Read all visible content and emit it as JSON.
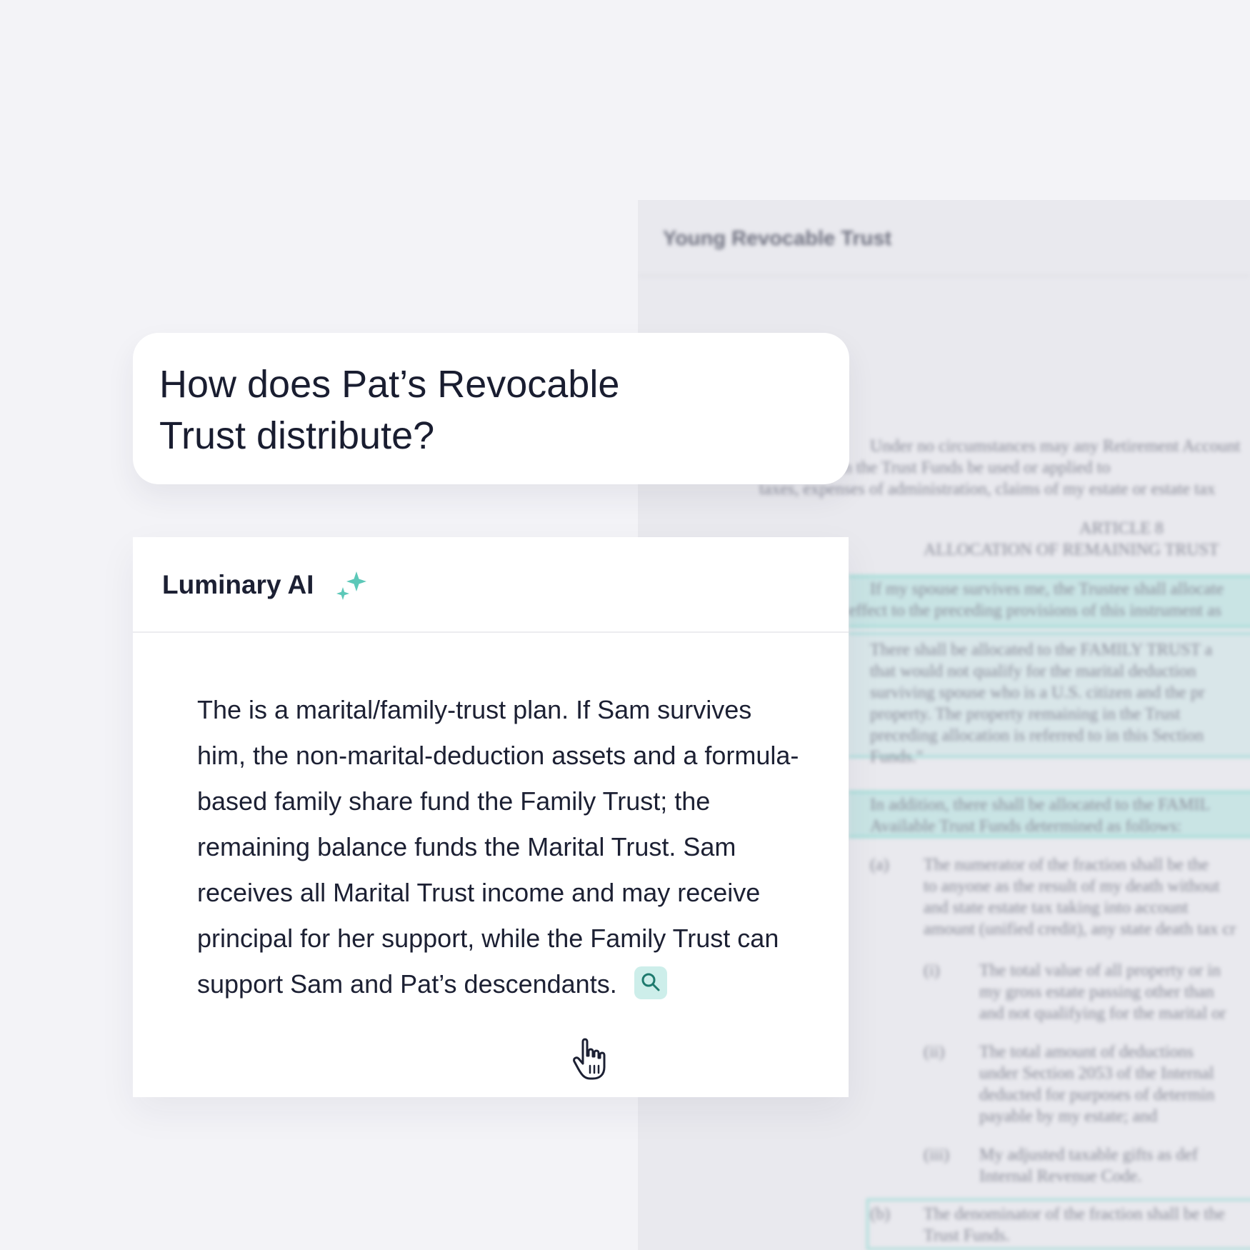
{
  "document": {
    "title": "Young Revocable Trust",
    "paragraphs": [
      "Under no circumstances may any Retirement Account",
      "that is held in the Trust Funds be used or applied to",
      "taxes, expenses of administration, claims of my estate or estate tax",
      "ARTICLE 8",
      "ALLOCATION OF REMAINING TRUST",
      "If my spouse survives me, the Trustee shall allocate",
      "effect to the preceding provisions of this instrument as",
      "There shall be allocated to the FAMILY TRUST a",
      "that would not qualify for the marital deduction",
      "surviving spouse who is a U.S. citizen and the pr",
      "property. The property remaining in the Trust",
      "preceding allocation is referred to in this Section",
      "Funds.\"",
      "In addition, there shall be allocated to the FAMIL",
      "Available Trust Funds determined as follows:",
      "(a)",
      "The numerator of the fraction shall be the",
      "to anyone as the result of my death without",
      "and state estate tax taking into account",
      "amount (unified credit), any state death tax cr",
      "(i)",
      "The total value of all property or in",
      "my gross estate passing other than",
      "and not qualifying for the marital or",
      "(ii)",
      "The total amount of deductions",
      "under Section 2053 of the Internal",
      "deducted for purposes of determin",
      "payable by my estate; and",
      "(iii)",
      "My adjusted taxable gifts as def",
      "Internal Revenue Code.",
      "(b)",
      "The denominator of the fraction shall be the",
      "Trust Funds."
    ]
  },
  "question": {
    "text": "How does Pat’s Revocable Trust distribute?"
  },
  "answer": {
    "assistant_name": "Luminary AI",
    "sparkle_icon": "sparkle-icon",
    "text": "The is a marital/family-trust plan. If Sam survives him, the non-marital-deduction assets and a formula-based family share fund the Family Trust; the remaining balance funds the Marital Trust. Sam receives all Marital Trust income and may receive principal for her support, while the Family Trust can support Sam and Pat’s descendants.",
    "citation_icon": "search-icon"
  },
  "colors": {
    "accent": "#5cc8b8",
    "highlight": "#cdeeea",
    "background": "#f3f3f7"
  }
}
